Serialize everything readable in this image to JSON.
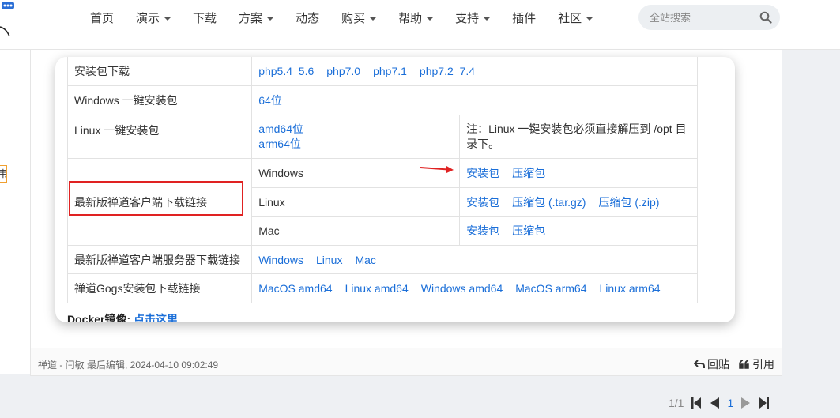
{
  "nav": {
    "items": [
      {
        "label": "首页",
        "dropdown": false
      },
      {
        "label": "演示",
        "dropdown": true
      },
      {
        "label": "下载",
        "dropdown": false
      },
      {
        "label": "方案",
        "dropdown": true
      },
      {
        "label": "动态",
        "dropdown": false
      },
      {
        "label": "购买",
        "dropdown": true
      },
      {
        "label": "帮助",
        "dropdown": true
      },
      {
        "label": "支持",
        "dropdown": true
      },
      {
        "label": "插件",
        "dropdown": false
      },
      {
        "label": "社区",
        "dropdown": true
      }
    ],
    "search_placeholder": "全站搜索"
  },
  "left_fragment": "韦",
  "table": {
    "row_php": {
      "label": "安装包下载",
      "links": [
        "php5.4_5.6",
        "php7.0",
        "php7.1",
        "php7.2_7.4"
      ]
    },
    "row_win": {
      "label": "Windows 一键安装包",
      "links": [
        "64位"
      ]
    },
    "row_linux": {
      "label": "Linux 一键安装包",
      "links": [
        "amd64位",
        "arm64位"
      ],
      "note": "注：Linux 一键安装包必须直接解压到 /opt 目录下。"
    },
    "row_client": {
      "label": "最新版禅道客户端下载链接",
      "platforms": [
        {
          "name": "Windows",
          "links": [
            "安装包",
            "压缩包"
          ]
        },
        {
          "name": "Linux",
          "links": [
            "安装包",
            "压缩包 (.tar.gz)",
            "压缩包 (.zip)"
          ]
        },
        {
          "name": "Mac",
          "links": [
            "安装包",
            "压缩包"
          ]
        }
      ]
    },
    "row_server": {
      "label": "最新版禅道客户端服务器下载链接",
      "links": [
        "Windows",
        "Linux",
        "Mac"
      ]
    },
    "row_gogs": {
      "label": "禅道Gogs安装包下载链接",
      "links": [
        "MacOS amd64",
        "Linux amd64",
        "Windows amd64",
        "MacOS arm64",
        "Linux arm64"
      ]
    }
  },
  "docker": {
    "label": "Docker镜像: ",
    "link": "点击这里"
  },
  "post_footer": {
    "meta": "禅道 - 闫敏 最后编辑, 2024-04-10 09:02:49",
    "reply": "回贴",
    "quote": "引用"
  },
  "pager": {
    "summary": "1/1",
    "current": "1"
  },
  "colors": {
    "link": "#1a6ed8",
    "warning": "#e03b3b",
    "highlight_box": "#e02222"
  }
}
